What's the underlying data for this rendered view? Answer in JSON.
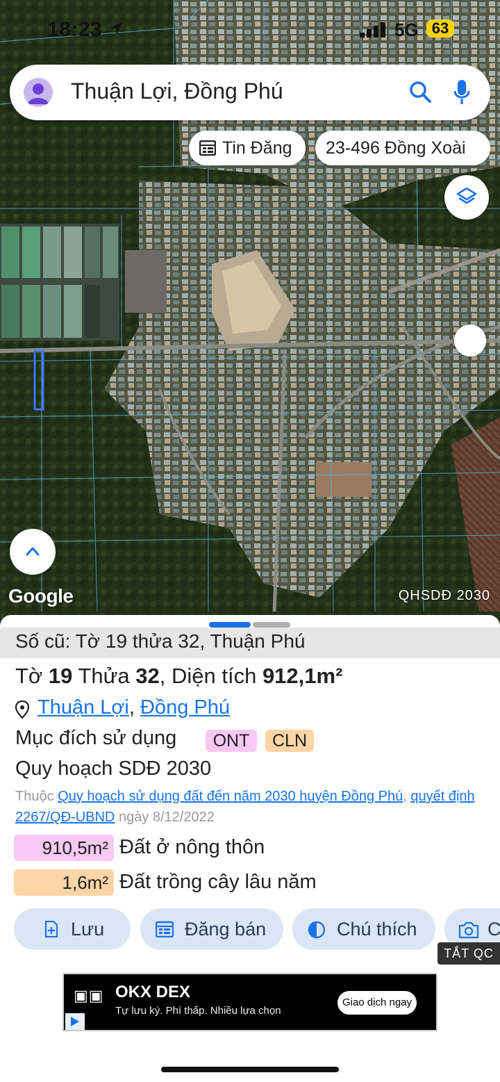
{
  "status": {
    "time": "18:23",
    "network": "5G",
    "battery": "63"
  },
  "search": {
    "query": "Thuận Lợi, Đồng Phú"
  },
  "chips": [
    {
      "label": "Tin Đăng",
      "icon": "listing-icon"
    },
    {
      "label": "23-496 Đồng Xoài"
    }
  ],
  "map": {
    "attribution": "Google",
    "plan_layer": "QHSDĐ 2030"
  },
  "parcel": {
    "old_info": "Số cũ: Tờ 19 thửa 32, Thuận Phú",
    "sheet_label": "Tờ",
    "sheet_no": "19",
    "parcel_label": "Thửa",
    "parcel_no": "32",
    "area_label": "Diện tích",
    "area_value": "912,1m²",
    "ward": "Thuận Lợi",
    "district": "Đồng Phú",
    "purpose_label": "Mục đích sử dụng",
    "purpose_tags": [
      "ONT",
      "CLN"
    ],
    "plan_title": "Quy hoạch SDĐ 2030",
    "source_prefix": "Thuộc",
    "source_link": "Quy hoạch sử dụng đất đến năm 2030 huyện Đồng Phú",
    "decision_link": "quyết định 2267/QĐ-UBND",
    "decision_date": "ngày 8/12/2022",
    "areas": [
      {
        "value": "910,5m²",
        "label": "Đất ở nông thôn",
        "color": "#f7c8f3"
      },
      {
        "value": "1,6m²",
        "label": "Đất trồng cây lâu năm",
        "color": "#fbd5a5"
      }
    ]
  },
  "actions": [
    {
      "label": "Lưu",
      "icon": "save-file-icon"
    },
    {
      "label": "Đăng bán",
      "icon": "calendar-icon"
    },
    {
      "label": "Chú thích",
      "icon": "contrast-icon"
    },
    {
      "label": "C",
      "icon": "camera-icon"
    }
  ],
  "ad": {
    "hide_label": "TẮT QC",
    "brand": "OKX DEX",
    "tagline": "Tự lưu ký. Phí thấp. Nhiều lựa chọn",
    "cta": "Giao dịch ngay"
  },
  "colors": {
    "accent": "#1a73e8",
    "ont": "#f7c8f3",
    "cln": "#fbd5a5",
    "button_bg": "#dae5f5"
  }
}
